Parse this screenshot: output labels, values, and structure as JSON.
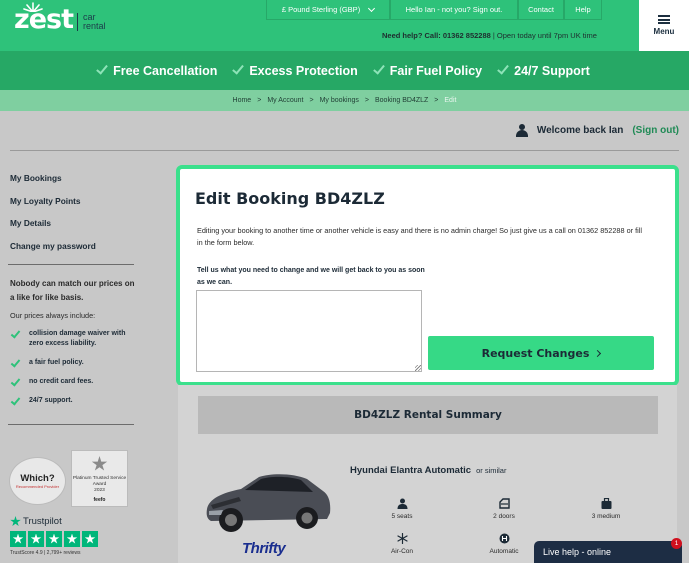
{
  "header": {
    "logo_word": "zest",
    "logo_sub_line1": "car",
    "logo_sub_line2": "rental",
    "currency": "£ Pound Sterling (GBP)",
    "hello": "Hello Ian - not you? Sign out.",
    "contact": "Contact",
    "help": "Help",
    "needhelp_bold": "Need help? Call: 01362 852288",
    "needhelp_rest": " | Open today until 7pm UK time",
    "menu_label": "Menu"
  },
  "features": [
    "Free Cancellation",
    "Excess Protection",
    "Fair Fuel Policy",
    "24/7 Support"
  ],
  "breadcrumb": [
    "Home",
    "My Account",
    "My bookings",
    "Booking BD4ZLZ",
    "Edit"
  ],
  "breadcrumb_sep": ">",
  "welcome": {
    "text": "Welcome back Ian",
    "signout": "(Sign out)"
  },
  "sidebar": {
    "links": [
      "My Bookings",
      "My Loyalty Points",
      "My Details",
      "Change my password"
    ],
    "match_heading": "Nobody can match our prices on a like for like basis.",
    "include_heading": "Our prices always include:",
    "includes": [
      "collision damage waiver with zero excess liability.",
      "a fair fuel policy.",
      "no credit card fees.",
      "24/7 support."
    ],
    "which_title": "Which?",
    "which_text": "Recommended Provider",
    "feefo_text": "Platinum Trusted Service Award",
    "feefo_year": "2023",
    "feefo_brand": "feefo",
    "trustpilot_name": "Trustpilot",
    "trustpilot_score": "TrustScore 4.9 | 2,799+ reviews"
  },
  "edit": {
    "title": "Edit Booking BD4ZLZ",
    "description": "Editing your booking to another time or another vehicle is easy and there is no admin charge! So just give us a call on 01362 852288 or fill in the form below.",
    "label": "Tell us what you need to change and we will get back to you as soon as we can.",
    "textarea_value": "",
    "button_label": "Request Changes"
  },
  "summary": {
    "heading": "BD4ZLZ Rental Summary",
    "car_name": "Hyundai Elantra Automatic",
    "car_similar": "or similar",
    "supplier": "Thrifty",
    "specs": [
      {
        "icon": "person-icon",
        "label": "5 seats"
      },
      {
        "icon": "door-icon",
        "label": "2 doors"
      },
      {
        "icon": "luggage-icon",
        "label": "3 medium"
      },
      {
        "icon": "snowflake-icon",
        "label": "Air-Con"
      },
      {
        "icon": "gearbox-icon",
        "label": "Automatic"
      }
    ]
  },
  "livehelp": {
    "label": "Live help - online",
    "badge": "1"
  },
  "colors": {
    "brand_green": "#2ec27a",
    "feature_bar": "#26a865",
    "breadcrumb_bar": "#7fcfa0",
    "navy": "#1c2a36"
  }
}
